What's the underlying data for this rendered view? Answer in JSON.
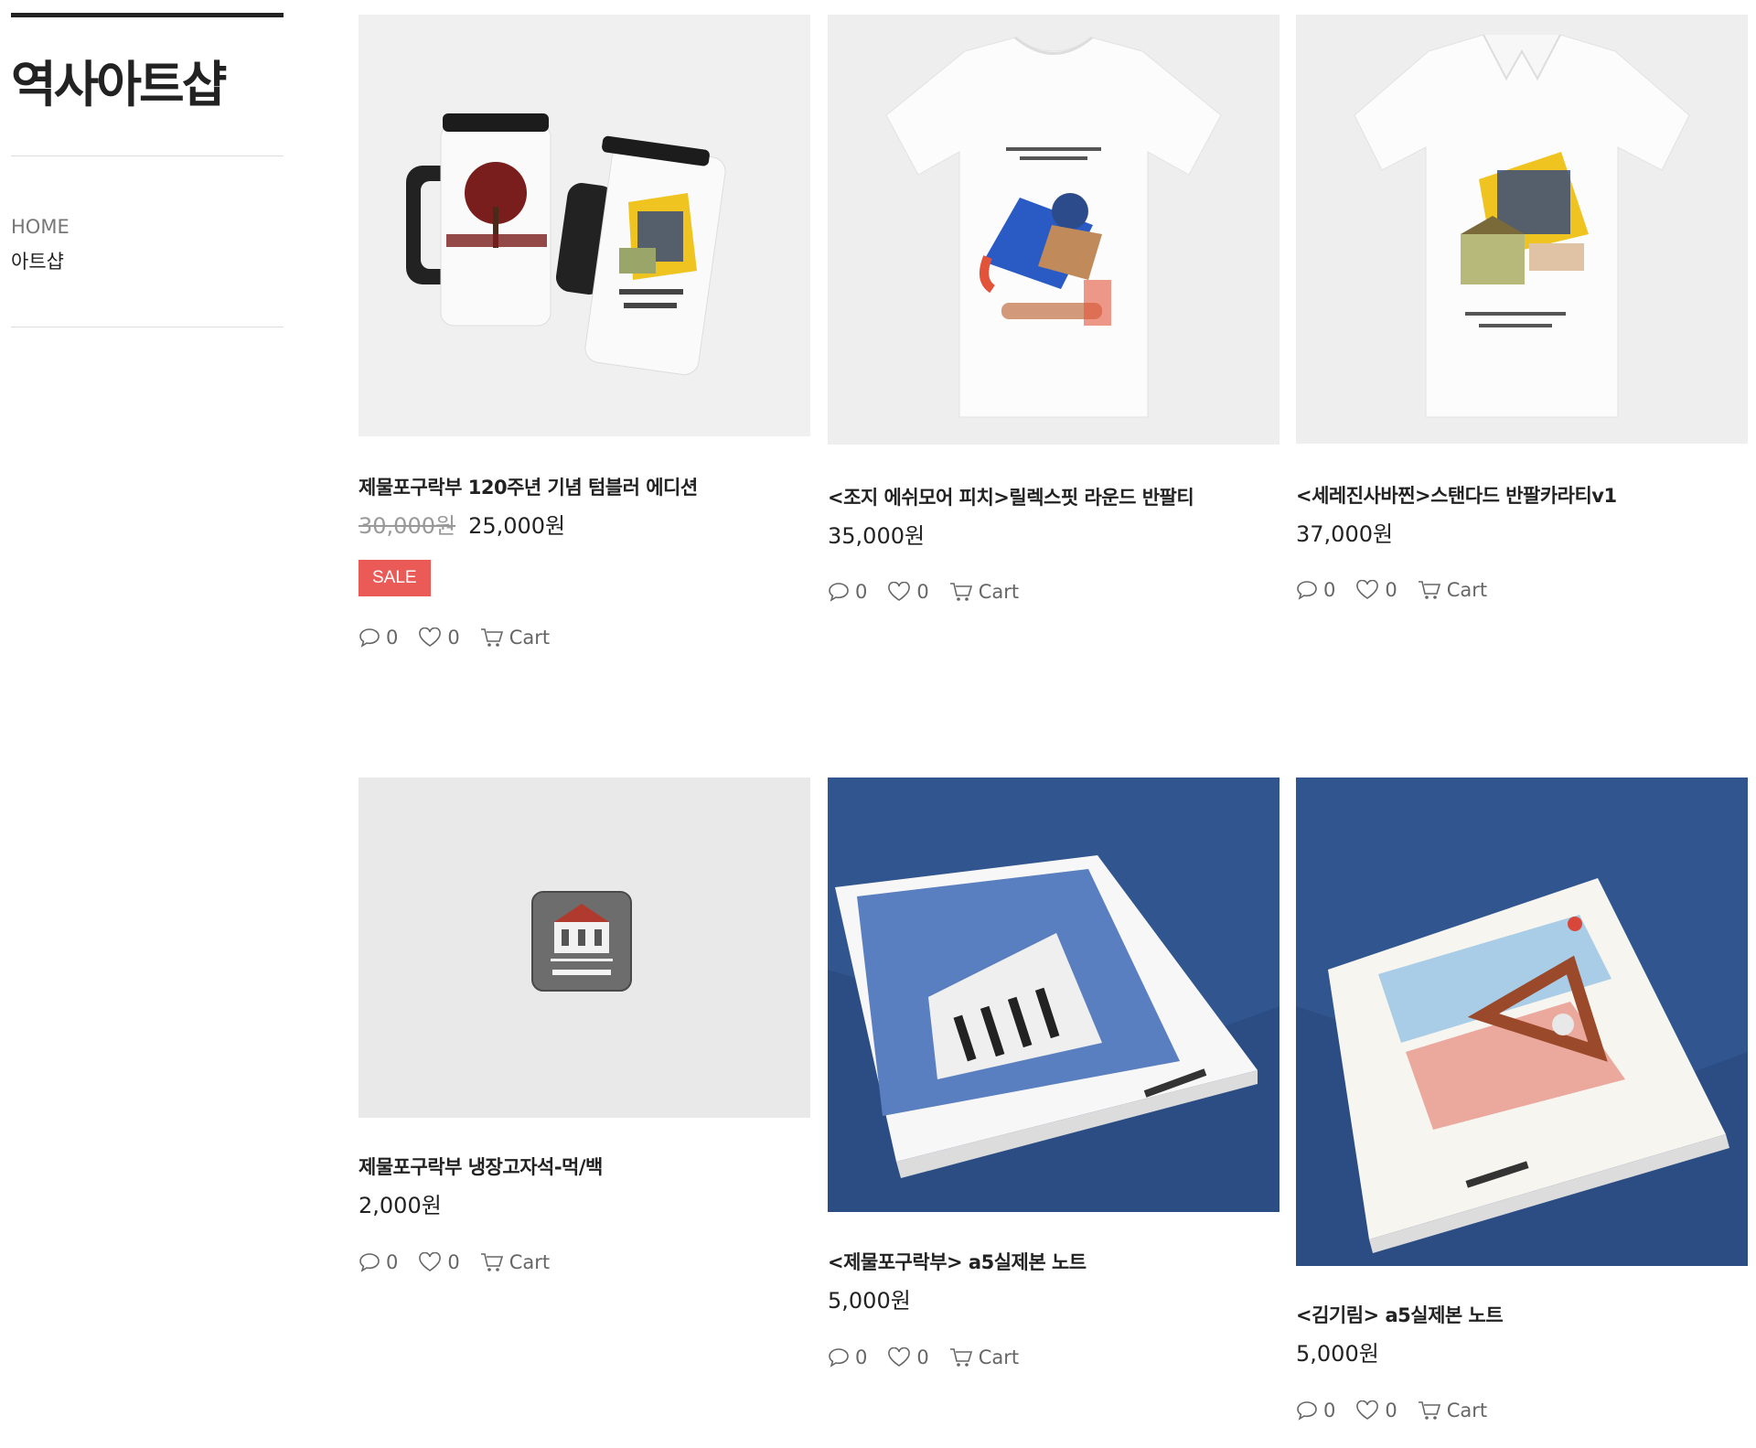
{
  "site": {
    "title": "역사아트샵"
  },
  "nav": {
    "items": [
      {
        "label": "HOME"
      },
      {
        "label": "아트샵"
      }
    ]
  },
  "cart_label": "Cart",
  "products": [
    {
      "name": "제물포구락부 120주년 기념 텀블러 에디션",
      "old_price": "30,000원",
      "price": "25,000원",
      "badge": "SALE",
      "comments": "0",
      "likes": "0"
    },
    {
      "name": "<조지 에쉬모어 피치>릴렉스핏 라운드 반팔티",
      "price": "35,000원",
      "comments": "0",
      "likes": "0"
    },
    {
      "name": "<세레진사바찐>스탠다드 반팔카라티v1",
      "price": "37,000원",
      "comments": "0",
      "likes": "0"
    },
    {
      "name": "제물포구락부 냉장고자석-먹/백",
      "price": "2,000원",
      "comments": "0",
      "likes": "0"
    },
    {
      "name": "<제물포구락부> a5실제본 노트",
      "price": "5,000원",
      "comments": "0",
      "likes": "0"
    },
    {
      "name": "<김기림> a5실제본 노트",
      "price": "5,000원",
      "comments": "0",
      "likes": "0"
    }
  ],
  "colors": {
    "sale_badge": "#ea5b57",
    "notebook_bg": "#2b4d84"
  }
}
